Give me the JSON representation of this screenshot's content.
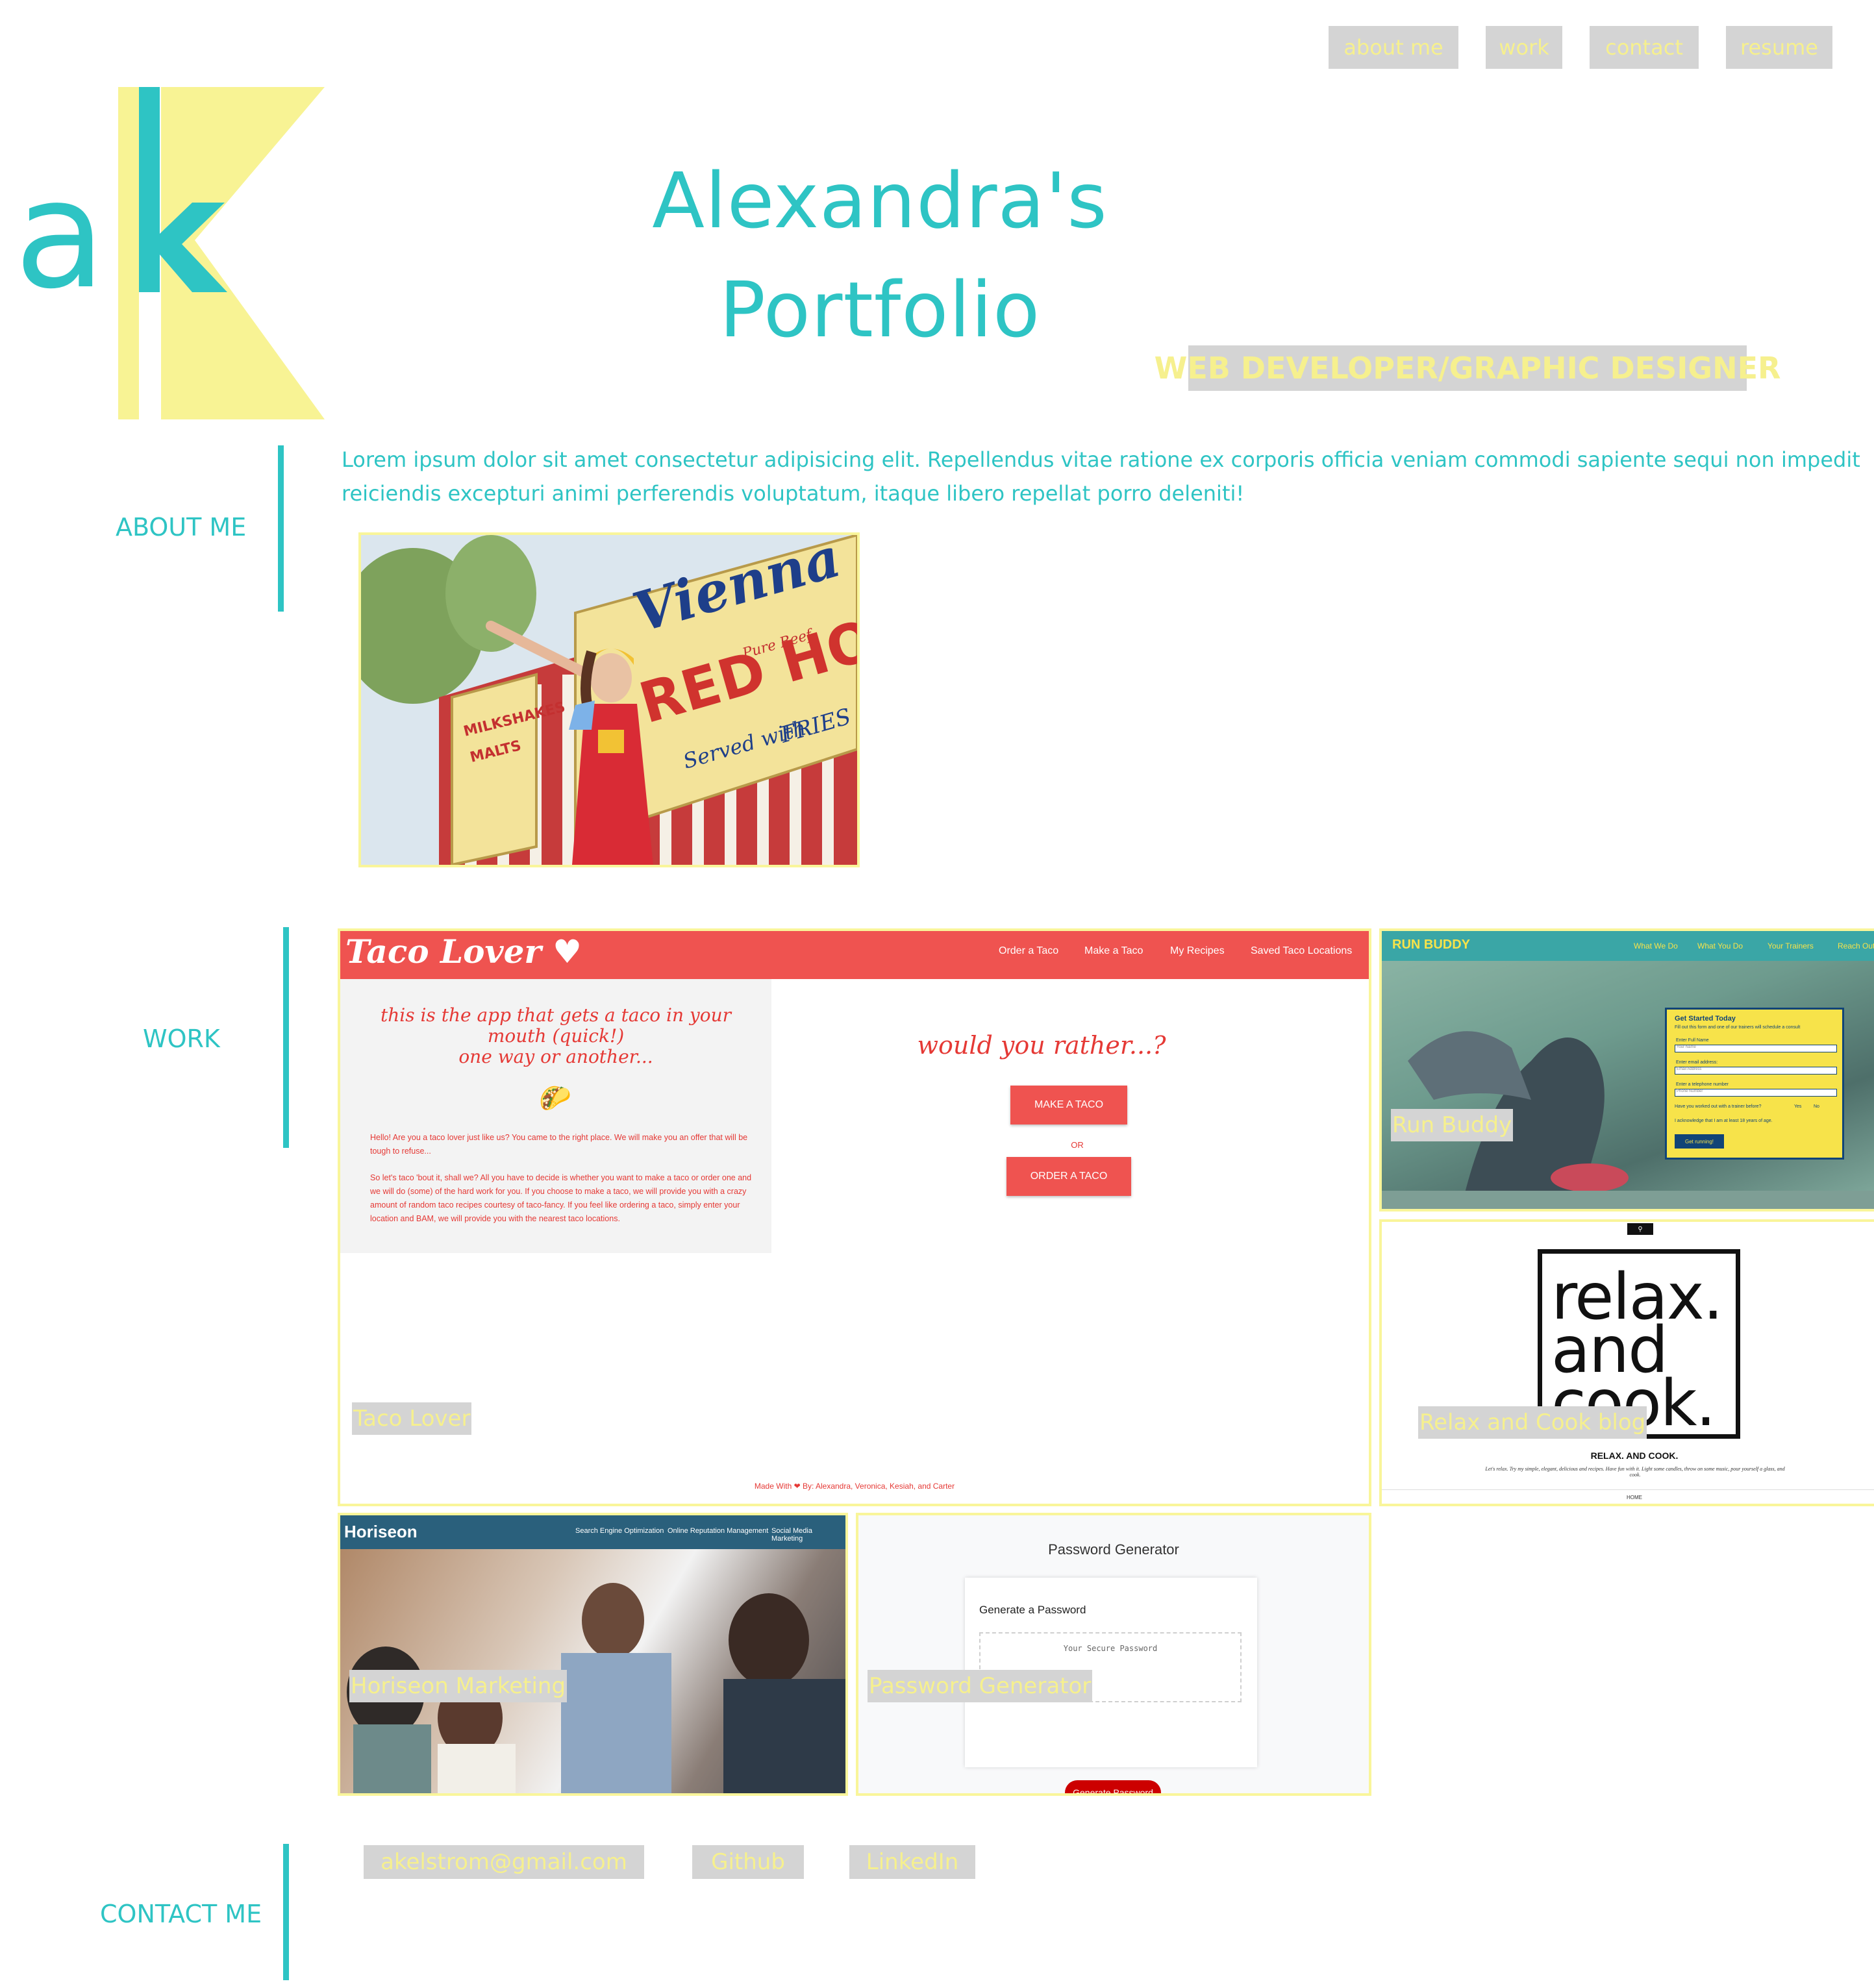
{
  "nav": {
    "items": [
      {
        "label": "about me"
      },
      {
        "label": "work"
      },
      {
        "label": "contact"
      },
      {
        "label": "resume"
      }
    ]
  },
  "header": {
    "logo_text": "ak",
    "title_line1": "Alexandra's",
    "title_line2": "Portfolio",
    "subtitle": "WEB DEVELOPER/GRAPHIC DESIGNER"
  },
  "about": {
    "label": "ABOUT ME",
    "text_line1": "Lorem ipsum dolor sit amet consectetur adipisicing elit. Repellendus vitae ratione ex corporis officia veniam commodi sapiente sequi non impedit",
    "text_line2": "reiciendis excepturi animi perferendis voluptatum, itaque libero repellat porro deleniti!",
    "photo_signs": {
      "vienna": "Vienna",
      "pure_beef": "Pure Beef",
      "red_hots": "RED HOTS",
      "served_with": "Served with",
      "fries": "FRIES",
      "milkshakes": "MILKSHAKES",
      "malts": "MALTS"
    }
  },
  "work": {
    "label": "WORK",
    "projects": [
      {
        "title": "Taco Lover",
        "screenshot": {
          "logo": "Taco Lover ♥",
          "nav": [
            "Order a Taco",
            "Make a Taco",
            "My Recipes",
            "Saved Taco Locations"
          ],
          "intro_title": "this is the app that gets a taco in your mouth (quick!)",
          "intro_sub": "one way or another...",
          "taco_emoji": "🌮",
          "para1": "Hello! Are you a taco lover just like us? You came to the right place. We will make you an offer that will be tough to refuse...",
          "para2": "So let's taco 'bout it, shall we? All you have to decide is whether you want to make a taco or order one and we will do (some) of the hard work for you. If you choose to make a taco, we will provide you with a crazy amount of random taco recipes courtesy of taco-fancy. If you feel like ordering a taco, simply enter your location and BAM, we will provide you with the nearest taco locations.",
          "question": "would you rather...?",
          "btn1": "MAKE A TACO",
          "or": "OR",
          "btn2": "ORDER A TACO",
          "footer": "Made With ❤ By: Alexandra, Veronica, Kesiah, and Carter"
        }
      },
      {
        "title": "Run Buddy",
        "screenshot": {
          "logo": "RUN BUDDY",
          "nav": [
            "What We Do",
            "What You Do",
            "Your Trainers",
            "Reach Out"
          ],
          "form_title": "Get Started Today",
          "form_sub": "Fill out this form and one of our trainers will schedule a consult",
          "fields": [
            {
              "label": "Enter Full Name",
              "placeholder": "Your Name"
            },
            {
              "label": "Enter email address:",
              "placeholder": "Email Address"
            },
            {
              "label": "Enter a telephone number",
              "placeholder": "Phone Number"
            }
          ],
          "question": "Have you worked out with a trainer before?",
          "yes": "Yes",
          "no": "No",
          "ack": "I acknowledge that I am at least 18 years of age.",
          "button": "Get running!"
        }
      },
      {
        "title": "Relax and Cook blog",
        "screenshot": {
          "search_icon": "search-icon",
          "logo_line1": "relax.",
          "logo_line2": "and",
          "logo_line3": "cook.",
          "tagline": "RELAX. AND COOK.",
          "blurb": "Let's relax. Try my simple, elegant, delicious and recipes. Have fun with it. Light some candles, throw on some music, pour yourself a glass, and cook.",
          "home": "HOME"
        }
      },
      {
        "title": "Horiseon Marketing",
        "screenshot": {
          "logo": "Horiseon",
          "nav": [
            "Search Engine Optimization",
            "Online Reputation Management",
            "Social Media Marketing"
          ]
        }
      },
      {
        "title": "Password Generator",
        "screenshot": {
          "title": "Password Generator",
          "card_title": "Generate a Password",
          "placeholder": "Your Secure Password",
          "button": "Generate Password"
        }
      }
    ]
  },
  "contact": {
    "label": "CONTACT ME",
    "links": [
      {
        "label": "akelstrom@gmail.com"
      },
      {
        "label": "Github"
      },
      {
        "label": "LinkedIn"
      }
    ]
  },
  "colors": {
    "teal": "#2ec4c4",
    "pale_yellow": "#f9f59a",
    "label_grey": "#d4d4d4",
    "label_text": "#f6f08e"
  }
}
